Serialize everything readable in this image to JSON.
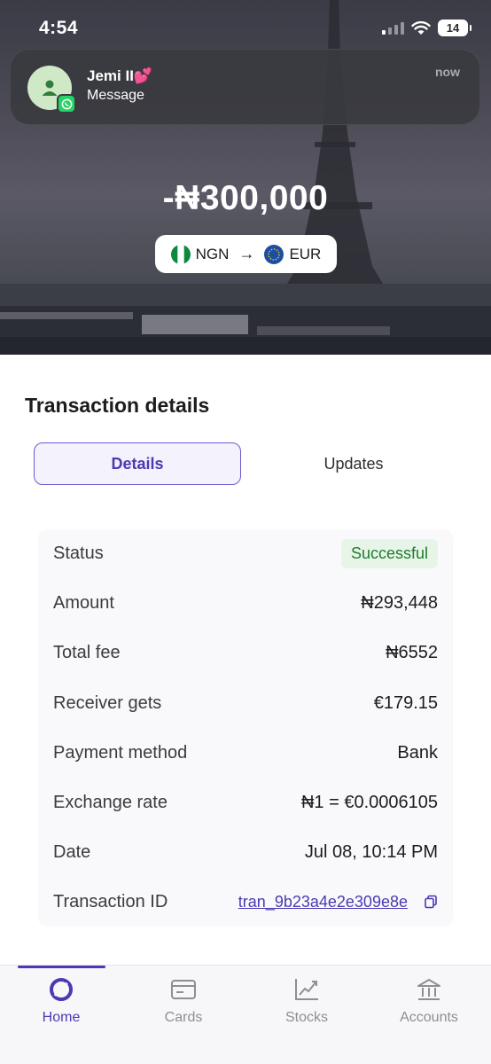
{
  "status_bar": {
    "time": "4:54",
    "battery": "14",
    "icons": [
      "cellular-signal-icon",
      "wifi-icon",
      "battery-charging-icon"
    ]
  },
  "notification": {
    "sender": "Jemi II💕",
    "message": "Message",
    "time": "now",
    "app_icon": "whatsapp-icon"
  },
  "transaction": {
    "amount": "-₦300,000",
    "from_currency": "NGN",
    "to_currency": "EUR",
    "from_flag": "nigeria-flag-icon",
    "to_flag": "eu-flag-icon"
  },
  "details": {
    "title": "Transaction details",
    "tabs": {
      "details": "Details",
      "updates": "Updates"
    },
    "active_tab": "Details",
    "rows": [
      {
        "label": "Status",
        "value": "Successful"
      },
      {
        "label": "Amount",
        "value": "₦293,448"
      },
      {
        "label": "Total fee",
        "value": "₦6552"
      },
      {
        "label": "Receiver gets",
        "value": "€179.15"
      },
      {
        "label": "Payment method",
        "value": "Bank"
      },
      {
        "label": "Exchange rate",
        "value": "₦1 = €0.0006105"
      },
      {
        "label": "Date",
        "value": "Jul 08, 10:14 PM"
      },
      {
        "label": "Transaction ID",
        "value": "tran_9b23a4e2e309e8e"
      }
    ]
  },
  "nav": {
    "items": [
      {
        "label": "Home",
        "icon": "home-logo-icon",
        "active": true
      },
      {
        "label": "Cards",
        "icon": "card-icon",
        "active": false
      },
      {
        "label": "Stocks",
        "icon": "chart-icon",
        "active": false
      },
      {
        "label": "Accounts",
        "icon": "bank-icon",
        "active": false
      }
    ]
  },
  "colors": {
    "accent": "#4a3ab3",
    "success_text": "#1f7a2e",
    "success_bg": "#e7f5e9"
  }
}
